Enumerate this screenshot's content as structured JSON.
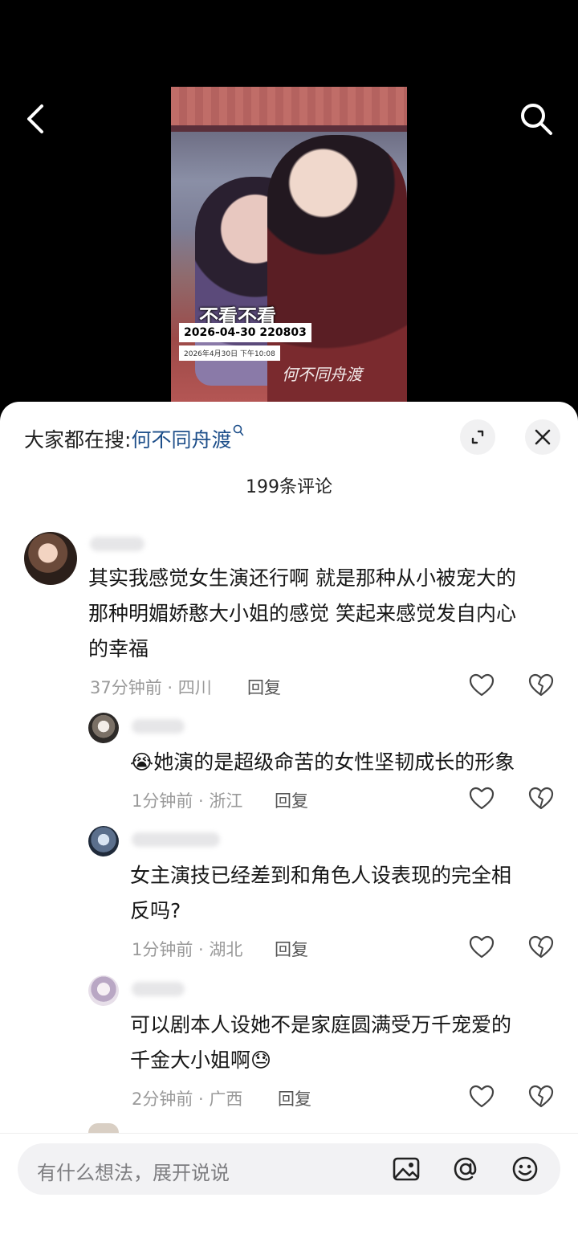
{
  "video": {
    "subtitle": "不看不看",
    "date_main": "2026-04-30 220803",
    "date_sub": "2026年4月30日 下午10:08",
    "signature": "何不同舟渡"
  },
  "sheet": {
    "hot_search_prefix": "大家都在搜:",
    "hot_search_keyword": "何不同舟渡",
    "comment_count": "199条评论"
  },
  "comments": [
    {
      "lines": [
        "其实我感觉女生演还行啊 就是那种从小被宠大的",
        "那种明媚娇憨大小姐的感觉 笑起来感觉发自内心",
        "的幸福"
      ],
      "meta": "37分钟前 · 四川",
      "reply": "回复"
    },
    {
      "lines": [
        "😭她演的是超级命苦的女性坚韧成长的形象"
      ],
      "meta": "1分钟前 · 浙江",
      "reply": "回复"
    },
    {
      "lines": [
        "女主演技已经差到和角色人设表现的完全相",
        "反吗?"
      ],
      "meta": "1分钟前 · 湖北",
      "reply": "回复"
    },
    {
      "lines": [
        "可以剧本人设她不是家庭圆满受万千宠爱的",
        "千金大小姐啊😓"
      ],
      "meta": "2分钟前 · 广西",
      "reply": "回复"
    }
  ],
  "input": {
    "placeholder": "有什么想法，展开说说"
  },
  "colors": {
    "keyword": "#1e4f8a",
    "meta": "#9a9a9a",
    "sheet_bg": "#ffffff"
  }
}
